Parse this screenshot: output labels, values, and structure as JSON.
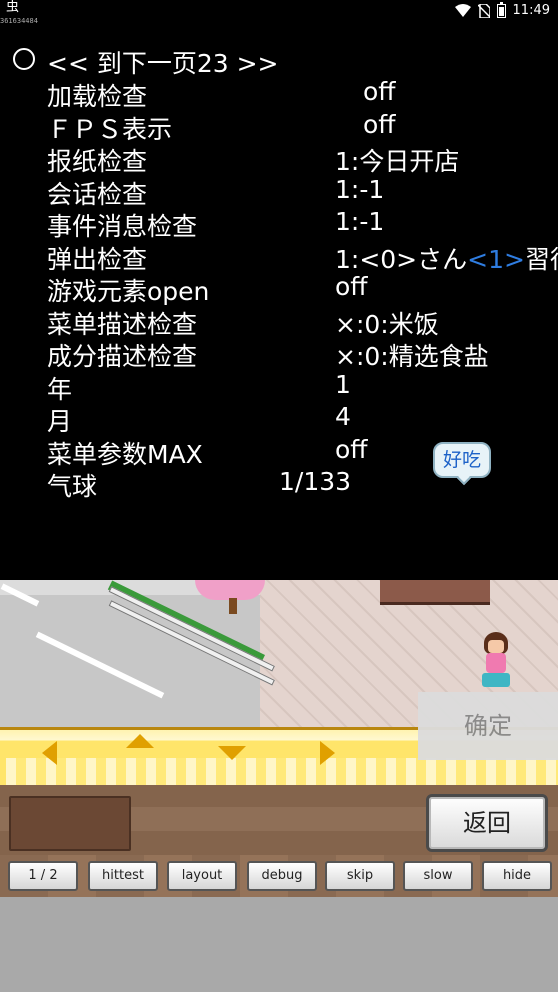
{
  "status_bar": {
    "app_glyph": "虫",
    "small_number": "361634484",
    "time": "11:49"
  },
  "debug_menu": {
    "title": "<< 到下一页23 >>",
    "rows": [
      {
        "label": "加载检查",
        "value": "off"
      },
      {
        "label": "ＦＰＳ表示",
        "value": "off"
      },
      {
        "label": "报纸检查",
        "value": "1:今日开店"
      },
      {
        "label": "会话检查",
        "value": "1:-1"
      },
      {
        "label": "事件消息检查",
        "value": "1:-1"
      },
      {
        "label": "弹出检查",
        "value_prefix": "1:<0>さん",
        "value_highlight": "<1>",
        "value_suffix": "習得"
      },
      {
        "label": "游戏元素open",
        "value": "off"
      },
      {
        "label": "菜单描述检查",
        "value": "×:0:米饭"
      },
      {
        "label": "成分描述检查",
        "value": "×:0:精选食盐"
      },
      {
        "label": "年",
        "value": "1"
      },
      {
        "label": "月",
        "value": "4"
      },
      {
        "label": "菜单参数MAX",
        "value": "off"
      },
      {
        "label": "气球",
        "value": "1/133"
      }
    ],
    "highlight_color": "#2f7de1"
  },
  "speech_bubble": {
    "text": "好吃"
  },
  "confirm_button": {
    "label": "确定"
  },
  "back_button": {
    "label": "返回"
  },
  "bottom_buttons": [
    "1 / 2",
    "hittest",
    "layout",
    "debug",
    "skip",
    "slow",
    "hide"
  ]
}
